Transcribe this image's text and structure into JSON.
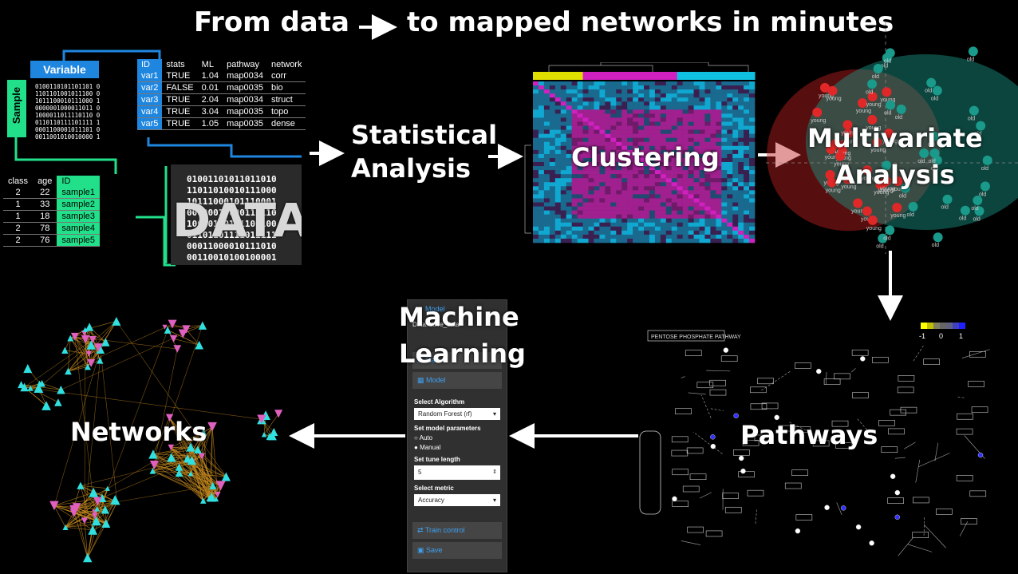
{
  "header": {
    "left": "From data",
    "right": "to mapped networks in minutes"
  },
  "labels": {
    "statistical": "Statistical",
    "analysis": "Analysis",
    "clustering": "Clustering",
    "multivariate": "Multivariate",
    "multi_analysis": "Analysis",
    "machine": "Machine",
    "learning": "Learning",
    "networks": "Networks",
    "pathways": "Pathways"
  },
  "data_block": {
    "variable_label": "Variable",
    "sample_label": "Sample",
    "data_label": "DATA",
    "small_binary": "0100110101101101 0\n1101101001011100 0\n1011100010111000 1\n0000001000011011 0\n1000011011110110 0\n0110110111101111 1\n0001100001011101 0\n0011001010010000 1",
    "big_binary": "01001101011011010\n11011010010111000\n10111000101110001\n00000010000110110\n10000110111101100\n01101101111011111\n00011000010111010\n00110010100100001"
  },
  "var_table": {
    "headers": [
      "ID",
      "stats",
      "ML",
      "pathway",
      "network"
    ],
    "rows": [
      [
        "var1",
        "TRUE",
        "1.04",
        "map0034",
        "corr"
      ],
      [
        "var2",
        "FALSE",
        "0.01",
        "map0035",
        "bio"
      ],
      [
        "var3",
        "TRUE",
        "2.04",
        "map0034",
        "struct"
      ],
      [
        "var4",
        "TRUE",
        "3.04",
        "map0035",
        "topo"
      ],
      [
        "var5",
        "TRUE",
        "1.05",
        "map0035",
        "dense"
      ]
    ]
  },
  "sample_table": {
    "headers": [
      "class",
      "age",
      "ID"
    ],
    "rows": [
      [
        "2",
        "22",
        "sample1"
      ],
      [
        "1",
        "33",
        "sample2"
      ],
      [
        "1",
        "18",
        "sample3"
      ],
      [
        "2",
        "78",
        "sample4"
      ],
      [
        "2",
        "76",
        "sample5"
      ]
    ]
  },
  "ml_panel": {
    "model_header": "Model",
    "data_line": "Data: dave_data",
    "data_btn": "Data",
    "model_btn": "Model",
    "select_algorithm": "Select Algorithm",
    "algorithm_value": "Random Forest (rf)",
    "set_params": "Set model parameters",
    "opt_auto": "Auto",
    "opt_manual": "Manual",
    "tune_label": "Set tune length",
    "tune_value": "5",
    "metric_label": "Select metric",
    "metric_value": "Accuracy",
    "train_btn": "Train control",
    "save_btn": "Save"
  },
  "pca": {
    "labels": [
      "young",
      "old"
    ]
  },
  "pathway": {
    "title": "PENTOSE PHOSPHATE PATHWAY",
    "legend_ticks": [
      "-1",
      "0",
      "1"
    ]
  },
  "colors": {
    "variable_blue": "#1f86e0",
    "sample_green": "#22e08a",
    "heat_magenta": "#d020c0",
    "heat_cyan": "#10c0e0",
    "pca_red": "#e02828",
    "pca_teal": "#1a9a8a",
    "net_edge": "#d09020",
    "net_cyan": "#30e0e0",
    "net_pink": "#e060c0"
  }
}
